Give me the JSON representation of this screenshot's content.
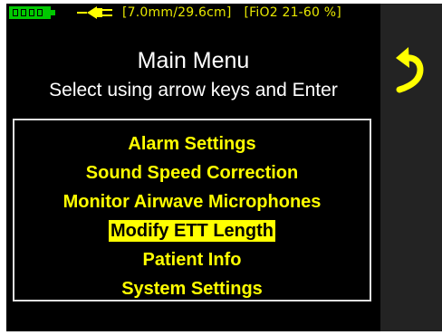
{
  "status": {
    "battery_icon": "battery-full-icon",
    "power_icon": "power-plug-icon",
    "ett_info": "[7.0mm/29.6cm]",
    "fio2_info": "[FiO2 21-60 %]"
  },
  "header": {
    "title": "Main Menu",
    "subtitle": "Select using arrow keys and Enter"
  },
  "menu": {
    "items": [
      {
        "label": "Alarm Settings",
        "selected": false
      },
      {
        "label": "Sound Speed Correction",
        "selected": false
      },
      {
        "label": "Monitor Airwave Microphones",
        "selected": false
      },
      {
        "label": "Modify ETT Length",
        "selected": true
      },
      {
        "label": "Patient Info",
        "selected": false
      },
      {
        "label": "System Settings",
        "selected": false
      }
    ]
  },
  "side_panel": {
    "back_icon": "back-arrow-icon"
  },
  "colors": {
    "screen_background": "#000000",
    "text_primary": "#ffffff",
    "accent_yellow": "#ffff00",
    "battery_green": "#00c800",
    "side_panel": "#232323"
  }
}
